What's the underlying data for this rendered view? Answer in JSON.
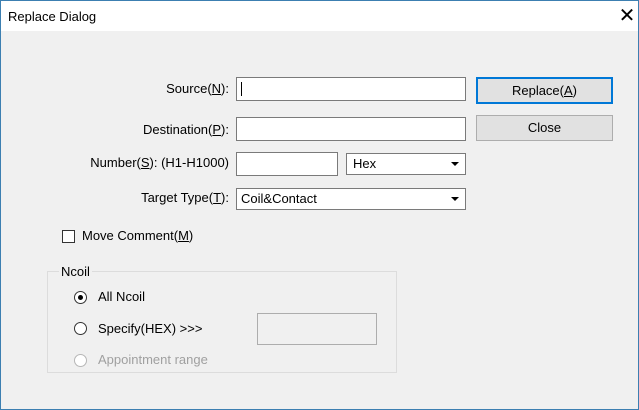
{
  "window": {
    "title": "Replace Dialog",
    "close_glyph": "✕"
  },
  "form": {
    "source": {
      "label_pre": "Source(",
      "label_mnemonic": "N",
      "label_post": "):",
      "value": ""
    },
    "destination": {
      "label_pre": "Destination(",
      "label_mnemonic": "P",
      "label_post": "):",
      "value": ""
    },
    "number": {
      "label_pre": "Number(",
      "label_mnemonic": "S",
      "label_post": "): (H1-H1000)",
      "value": "",
      "radix_selected": "Hex"
    },
    "target_type": {
      "label_pre": "Target Type(",
      "label_mnemonic": "T",
      "label_post": "):",
      "selected": "Coil&Contact"
    },
    "move_comment": {
      "label_pre": "Move Comment(",
      "label_mnemonic": "M",
      "label_post": ")",
      "checked": false
    }
  },
  "buttons": {
    "replace": {
      "label_pre": "Replace(",
      "label_mnemonic": "A",
      "label_post": ")"
    },
    "close": {
      "label": "Close"
    }
  },
  "ncoil": {
    "group_label": "Ncoil",
    "options": [
      {
        "label": "All Ncoil",
        "selected": true,
        "enabled": true
      },
      {
        "label": "Specify(HEX) >>>",
        "selected": false,
        "enabled": true
      },
      {
        "label": "Appointment range",
        "selected": false,
        "enabled": false
      }
    ],
    "specify_value": ""
  },
  "colors": {
    "dialog_bg": "#f0f0f0",
    "title_bg": "#ffffff",
    "default_button_border": "#0078d7",
    "disabled_text": "#a0a0a0"
  },
  "icons": {
    "combo_arrow": "triangle-down-icon",
    "close": "close-icon"
  }
}
